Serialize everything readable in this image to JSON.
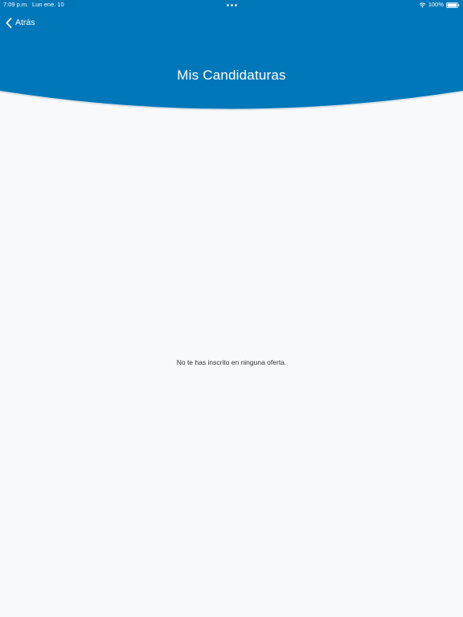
{
  "status_bar": {
    "time": "7:09 p.m.",
    "date": "Lun ene. 10",
    "battery": "100%"
  },
  "nav": {
    "back_label": "Atrás"
  },
  "header": {
    "title": "Mis Candidaturas"
  },
  "content": {
    "empty_message": "No te has inscrito en ninguna oferta."
  },
  "colors": {
    "header_bg": "#0077b8",
    "page_bg": "#f8f9fa",
    "text_dark": "#333333"
  },
  "icons": {
    "back": "chevron-left-icon",
    "wifi": "wifi-icon",
    "battery": "battery-icon",
    "multitask": "multitasking-dots-icon"
  }
}
